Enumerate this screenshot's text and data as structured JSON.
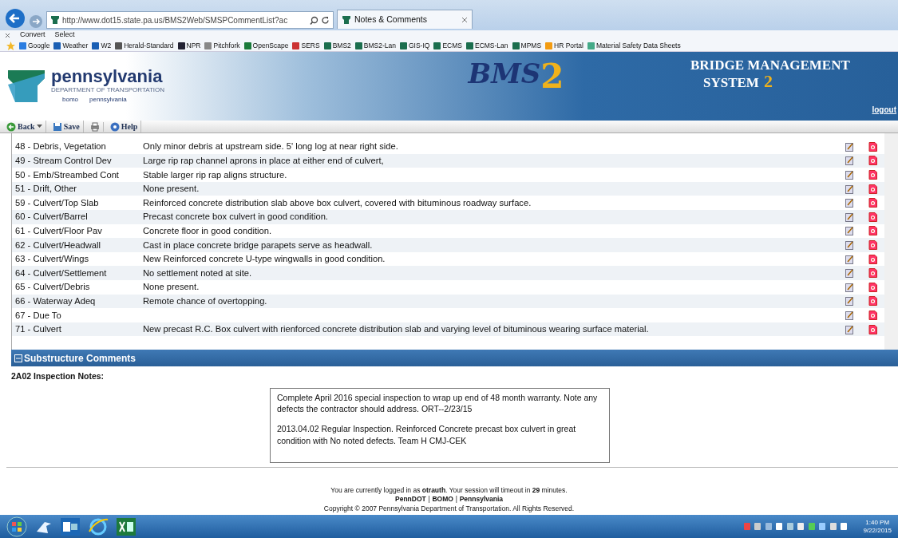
{
  "browser": {
    "address": "http://www.dot15.state.pa.us/BMS2Web/SMSPCommentList?ac",
    "tab_title": "Notes & Comments",
    "command_bar": [
      "Convert",
      "Select"
    ],
    "favorites": [
      "Google",
      "Weather",
      "W2",
      "Herald-Standard",
      "NPR",
      "Pitchfork",
      "OpenScape",
      "SERS",
      "BMS2",
      "BMS2-Lan",
      "GIS-IQ",
      "ECMS",
      "ECMS-Lan",
      "MPMS",
      "HR Portal",
      "Material Safety Data Sheets"
    ]
  },
  "header": {
    "state_name": "pennsylvania",
    "department": "DEPARTMENT OF TRANSPORTATION",
    "sub_left": "bomo",
    "sub_right": "pennsylvania",
    "logo_letters": "BMS",
    "logo_number": "2",
    "title_line1": "BRIDGE MANAGEMENT",
    "title_line2": "SYSTEM",
    "title_number": "2",
    "logout": "logout"
  },
  "toolbar": [
    {
      "kind": "back",
      "label": "Back"
    },
    {
      "kind": "save",
      "label": "Save"
    },
    {
      "kind": "print"
    },
    {
      "kind": "help",
      "label": "Help"
    }
  ],
  "comments": [
    {
      "item": "48 - Debris, Vegetation",
      "comment": "Only minor debris at upstream side. 5' long log at near right side."
    },
    {
      "item": "49 - Stream Control Dev",
      "comment": "Large rip rap channel aprons in place at either end of culvert,"
    },
    {
      "item": "50 - Emb/Streambed Cont",
      "comment": "Stable larger rip rap aligns structure."
    },
    {
      "item": "51 - Drift, Other",
      "comment": "None present."
    },
    {
      "item": "59 - Culvert/Top Slab",
      "comment": "Reinforced concrete distribution slab above box culvert, covered with bituminous roadway surface."
    },
    {
      "item": "60 - Culvert/Barrel",
      "comment": "Precast concrete box culvert in good condition."
    },
    {
      "item": "61 - Culvert/Floor Pav",
      "comment": "Concrete floor in good condition."
    },
    {
      "item": "62 - Culvert/Headwall",
      "comment": "Cast in place concrete bridge parapets serve as headwall."
    },
    {
      "item": "63 - Culvert/Wings",
      "comment": "New Reinforced concrete U-type wingwalls in good condition."
    },
    {
      "item": "64 - Culvert/Settlement",
      "comment": "No settlement noted at site."
    },
    {
      "item": "65 - Culvert/Debris",
      "comment": "None present."
    },
    {
      "item": "66 - Waterway Adeq",
      "comment": "Remote chance of overtopping."
    },
    {
      "item": "67 - Due To"
    },
    {
      "item": "71 - Culvert",
      "comment": "New precast R.C. Box culvert with rienforced concrete distribution slab and varying level of bituminous wearing surface material."
    }
  ],
  "section": {
    "title": "Substructure Comments",
    "expanded": true
  },
  "notes_label": "2A02 Inspection Notes:",
  "notes": [
    "Complete April 2016 special inspection to wrap up end of 48 month warranty. Note any defects the contractor should address. ORT--2/23/15",
    "2013.04.02  Regular Inspection. Reinforced Concrete precast box culvert in great condition with No noted defects.  Team H  CMJ-CEK"
  ],
  "footer": {
    "session": "You are currently logged in as **otrauth**. Your session will timeout in **29** minutes.",
    "links": [
      "PennDOT",
      "BOMO",
      "Pennsylvania"
    ],
    "separator": "|",
    "copyright": "Copyright © 2007 Pennsylvania Department of Transportation. All Rights Reserved."
  },
  "taskbar": {
    "time": "1:40 PM",
    "date": "9/22/2015"
  }
}
